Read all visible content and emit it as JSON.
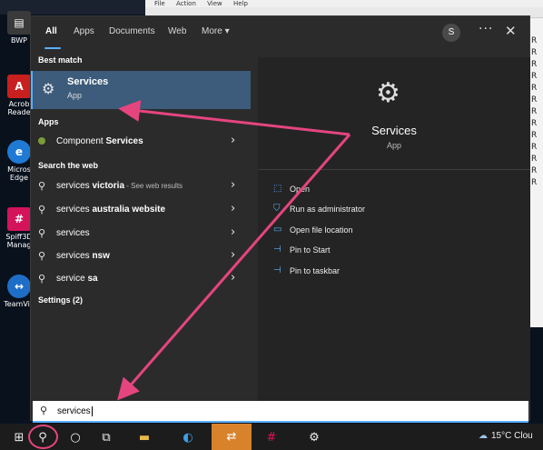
{
  "desktop": {
    "icons": [
      {
        "label": "BWP",
        "color": "#444"
      },
      {
        "label": "Acrob Reade",
        "color": "#c8201e"
      },
      {
        "label": "Micros Edge",
        "color": "#1f7ad6"
      },
      {
        "label": "Spiff3D Manag",
        "color": "#d4145a"
      },
      {
        "label": "TeamVie",
        "color": "#1e6ec8"
      }
    ]
  },
  "background_window": {
    "menu": [
      "File",
      "Action",
      "View",
      "Help"
    ],
    "right_col": [
      "R",
      "R",
      "R",
      "R",
      "R",
      "R",
      "R",
      "R",
      "R",
      "R",
      "R",
      "R",
      "R"
    ]
  },
  "search": {
    "tabs": [
      "All",
      "Apps",
      "Documents",
      "Web",
      "More"
    ],
    "avatar_initial": "S",
    "more_dots": "···",
    "best_match_header": "Best match",
    "best_match": {
      "title": "Services",
      "subtitle": "App"
    },
    "apps_header": "Apps",
    "apps": [
      {
        "prefix": "Component ",
        "bold": "Services"
      }
    ],
    "web_header": "Search the web",
    "web_results": [
      {
        "prefix": "services ",
        "bold": "victoria",
        "suffix": " - See web results"
      },
      {
        "prefix": "services ",
        "bold": "australia website",
        "suffix": ""
      },
      {
        "prefix": "services",
        "bold": "",
        "suffix": ""
      },
      {
        "prefix": "services ",
        "bold": "nsw",
        "suffix": ""
      },
      {
        "prefix": "service ",
        "bold": "sa",
        "suffix": ""
      }
    ],
    "settings_header": "Settings (2)",
    "preview": {
      "title": "Services",
      "subtitle": "App",
      "actions": [
        "Open",
        "Run as administrator",
        "Open file location",
        "Pin to Start",
        "Pin to taskbar"
      ]
    },
    "query": "services"
  },
  "taskbar": {
    "weather_temp": "15°C",
    "weather_text": "Clou"
  },
  "colors": {
    "accent": "#5ab0ff",
    "selection": "#3d5b7a",
    "annotation": "#e5457f"
  }
}
